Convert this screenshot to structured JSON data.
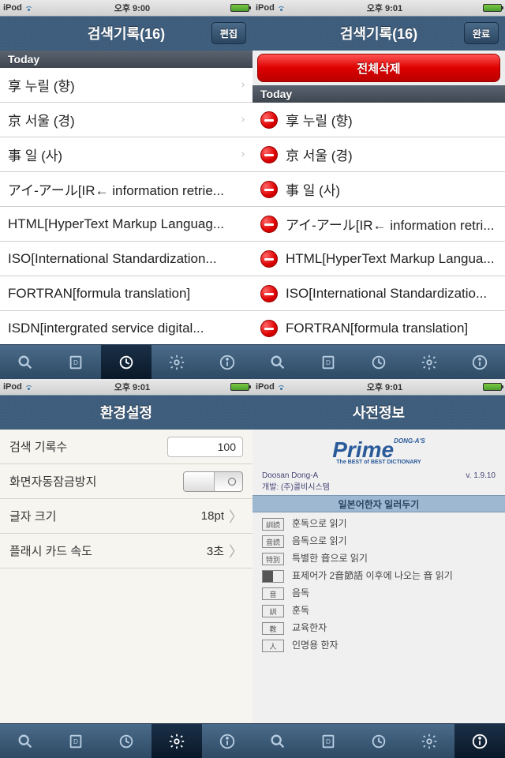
{
  "p1": {
    "status": {
      "device": "iPod",
      "time": "오후 9:00"
    },
    "title": "검색기록(16)",
    "button": "편집",
    "section": "Today",
    "items": [
      "享 누릴 (향)",
      "京 서울 (경)",
      "事 일 (사)",
      "アイ-アール[IR← information retrie...",
      "HTML[HyperText Markup Languag...",
      "ISO[International Standardization...",
      "FORTRAN[formula translation]",
      "ISDN[intergrated service digital..."
    ]
  },
  "p2": {
    "status": {
      "device": "iPod",
      "time": "오후 9:01"
    },
    "title": "검색기록(16)",
    "button": "완료",
    "delete_all": "전체삭제",
    "section": "Today",
    "items": [
      "享 누릴 (향)",
      "京 서울 (경)",
      "事 일 (사)",
      "アイ-アール[IR← information retri...",
      "HTML[HyperText Markup Langua...",
      "ISO[International Standardizatio...",
      "FORTRAN[formula translation]"
    ]
  },
  "p3": {
    "status": {
      "device": "iPod",
      "time": "오후 9:01"
    },
    "title": "환경설정",
    "rows": {
      "r1": {
        "label": "검색 기록수",
        "value": "100"
      },
      "r2": {
        "label": "화면자동잠금방지"
      },
      "r3": {
        "label": "글자 크기",
        "value": "18pt"
      },
      "r4": {
        "label": "플래시 카드 속도",
        "value": "3초"
      }
    }
  },
  "p4": {
    "status": {
      "device": "iPod",
      "time": "오후 9:01"
    },
    "title": "사전정보",
    "logo": "Prime",
    "logo_tag": "The BEST of BEST DICTIONARY",
    "logo_sup": "DONG-A'S",
    "company": "Doosan Dong-A",
    "dev": "개발: (주)콜비시스템",
    "version": "v. 1.9.10",
    "section": "일본어한자 일러두기",
    "defs": [
      {
        "tag": "訓読",
        "text": "훈독으로 읽기"
      },
      {
        "tag": "音読",
        "text": "음독으로 읽기"
      },
      {
        "tag": "特別",
        "text": "특별한 音으로 읽기"
      },
      {
        "tag": "",
        "text": "표제어가 2音節語 이후에 나오는 音 읽기",
        "half": true
      },
      {
        "tag": "音",
        "text": "음독"
      },
      {
        "tag": "訓",
        "text": "훈독"
      },
      {
        "tag": "教",
        "text": "교육한자"
      },
      {
        "tag": "人",
        "text": "인명용 한자"
      }
    ]
  }
}
